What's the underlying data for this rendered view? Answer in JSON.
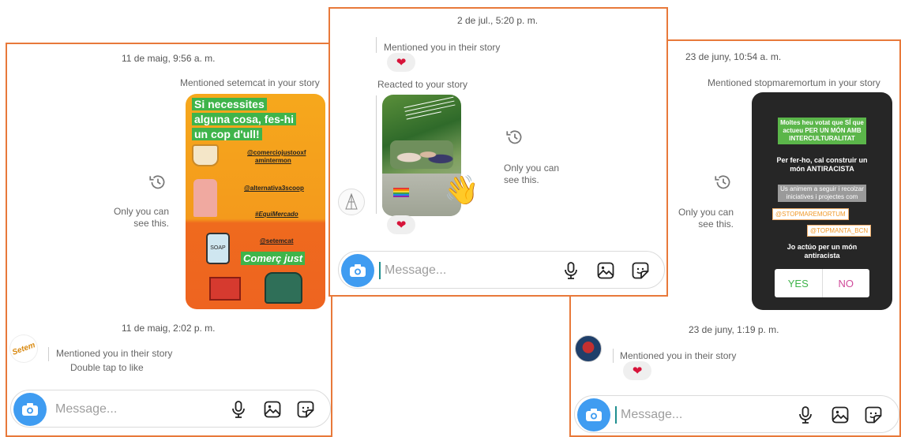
{
  "left": {
    "timestamp1": "11 de maig, 9:56 a. m.",
    "mention_label": "Mentioned setemcat in your story",
    "story": {
      "headline": [
        "Si necessites",
        "alguna cosa, fes-hi",
        "un cop d'ull!"
      ],
      "tags": [
        "@comerciojustooxf",
        "amintermon",
        "@alternativa3scoop",
        "#EquiMercado",
        "@setemcat"
      ],
      "big_label": "Comerç just",
      "soap_label": "SOAP"
    },
    "only_you": [
      "Only you can",
      "see this."
    ],
    "timestamp2": "11 de maig, 2:02 p. m.",
    "avatar_text": "Setem",
    "mention_you": "Mentioned you in their story",
    "double_tap": "Double tap to like",
    "composer_placeholder": "Message..."
  },
  "middle": {
    "timestamp": "2 de jul., 5:20 p. m.",
    "mention_you": "Mentioned you in their story",
    "reacted": "Reacted to your story",
    "only_you": [
      "Only you can",
      "see this."
    ],
    "composer_placeholder": "Message..."
  },
  "right": {
    "timestamp1": "23 de juny, 10:54 a. m.",
    "mention_label": "Mentioned stopmaremortum in your story",
    "story": {
      "hl1": [
        "Moltes heu votat que SÍ que",
        "actueu PER UN MÓN AMB",
        "INTERCULTURALITAT"
      ],
      "line2": [
        "Per fer-ho, cal construir un",
        "món ANTIRACISTA"
      ],
      "hl2": [
        "Us animem a seguir i recolzar",
        "iniciatives i projectes com"
      ],
      "tag1": "@STOPMAREMORTUM",
      "tag2": "@TOPMANTA_BCN",
      "question": [
        "Jo actúo per un món",
        "antiracista"
      ],
      "poll_yes": "YES",
      "poll_no": "NO"
    },
    "only_you": [
      "Only you can",
      "see this."
    ],
    "timestamp2": "23 de juny, 1:19 p. m.",
    "mention_you": "Mentioned you in their story",
    "composer_placeholder": "Message..."
  },
  "colors": {
    "frame": "#e8793a",
    "camera": "#3f9cf1",
    "heart": "#d7143a",
    "accent_green": "#3fb44a"
  }
}
